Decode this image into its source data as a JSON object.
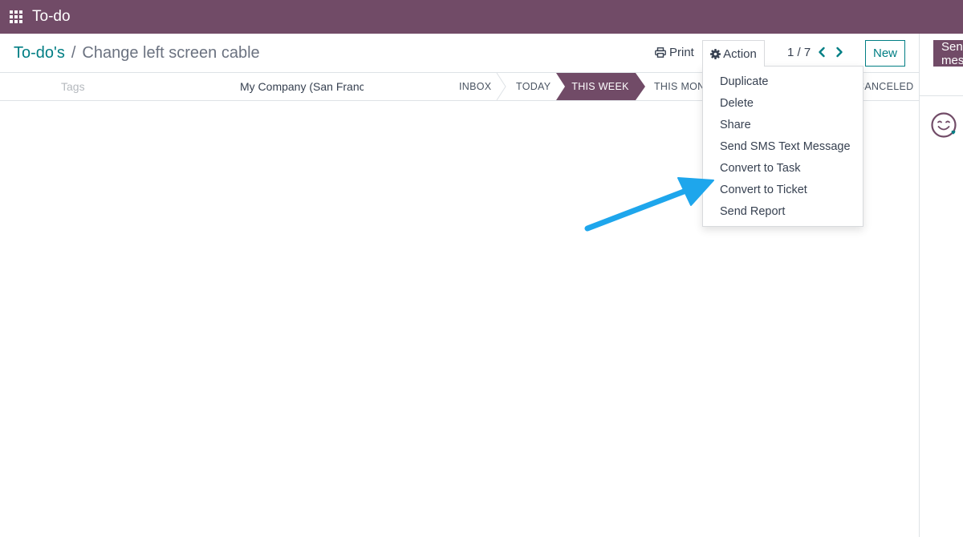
{
  "topbar": {
    "app_title": "To-do"
  },
  "breadcrumb": {
    "parent": "To-do's",
    "separator": "/",
    "current": "Change left screen cable"
  },
  "controlpanel": {
    "print_label": "Print",
    "action_label": "Action",
    "pager": "1 / 7",
    "new_label": "New"
  },
  "statusbar": {
    "tags_placeholder": "Tags",
    "company": "My Company (San Francisco)",
    "stages": [
      "INBOX",
      "TODAY",
      "THIS WEEK",
      "THIS MONTH",
      "CANCELED"
    ],
    "active_stage": "THIS WEEK"
  },
  "action_menu": {
    "items": [
      "Duplicate",
      "Delete",
      "Share",
      "Send SMS Text Message",
      "Convert to Task",
      "Convert to Ticket",
      "Send Report"
    ]
  },
  "chatter": {
    "send_label": "Send message"
  },
  "colors": {
    "brand": "#714b67",
    "accent": "#017e84",
    "arrow": "#1ea6ec"
  },
  "icons": {
    "apps": "apps-grid-icon",
    "print": "print-icon",
    "gear": "gear-icon",
    "prev": "chevron-left-icon",
    "next": "chevron-right-icon",
    "avatar": "bot-avatar-icon"
  }
}
